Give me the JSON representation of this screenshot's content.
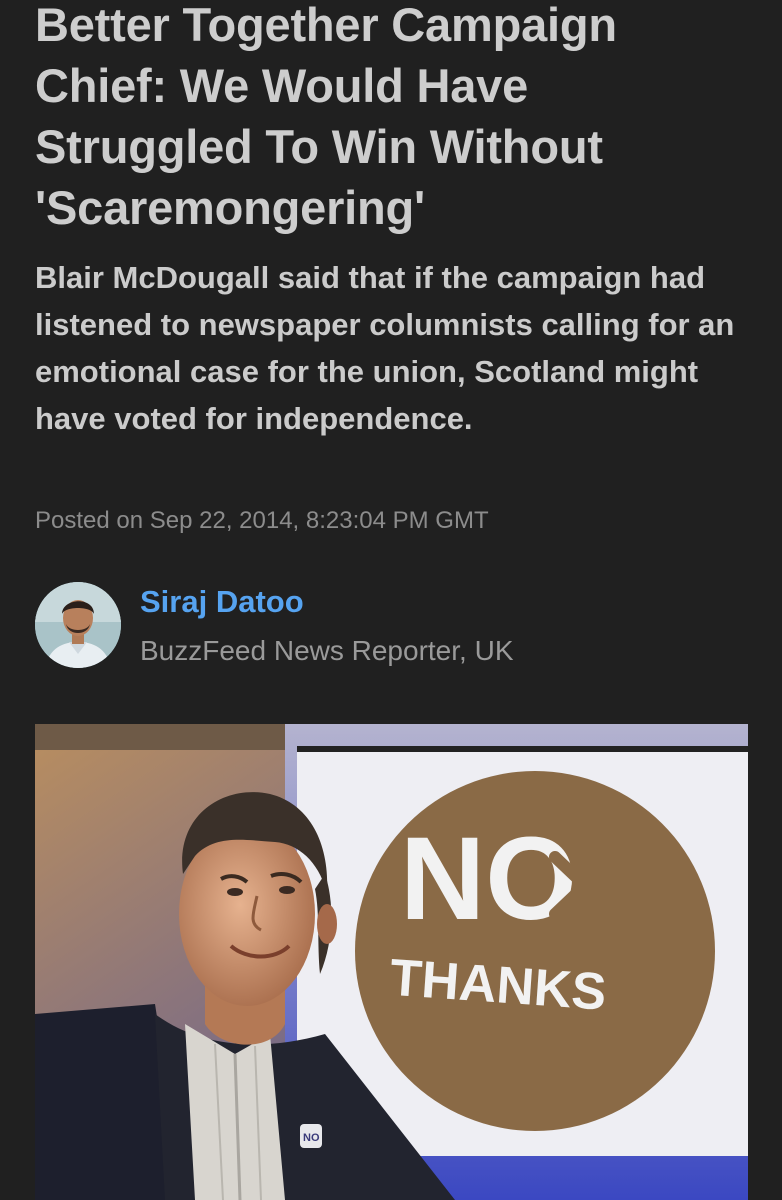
{
  "article": {
    "headline": "Better Together Campaign Chief: We Would Have Struggled To Win Without 'Scaremongering'",
    "dek": "Blair McDougall said that if the campaign had listened to newspaper columnists calling for an emotional case for the union, Scotland might have voted for independence.",
    "timestamp": "Posted on Sep 22, 2014, 8:23:04 PM GMT"
  },
  "author": {
    "name": "Siraj Datoo",
    "role": "BuzzFeed News Reporter, UK"
  },
  "hero_image": {
    "sign_word": "NO",
    "sign_sub": "THANKS",
    "badge_text": "NO"
  },
  "colors": {
    "background": "#202020",
    "headline": "#cdcdcd",
    "author_link": "#56a3f0",
    "muted": "#8c8c8c",
    "sign_circle": "#8a6a46"
  }
}
